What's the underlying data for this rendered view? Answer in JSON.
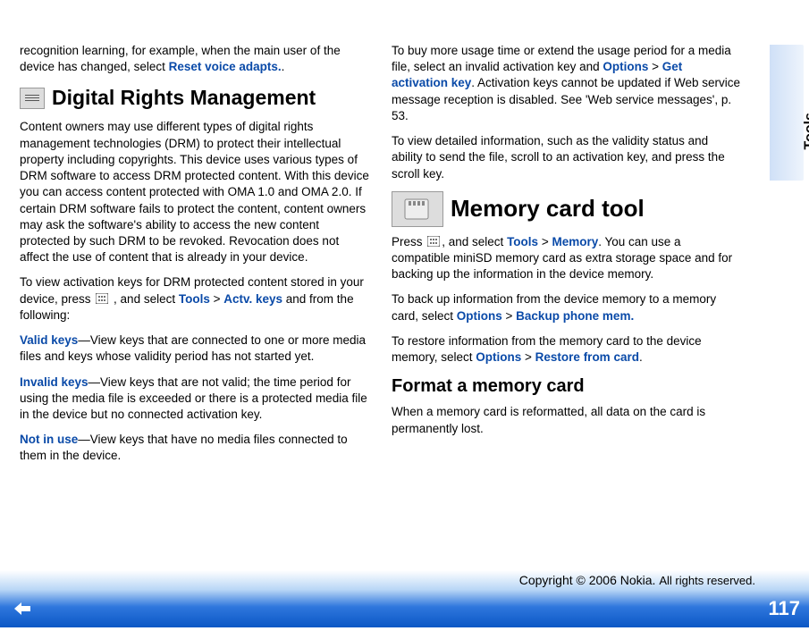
{
  "side_tab": "Tools",
  "left": {
    "intro_pre": "recognition learning, for example, when the main user of the device has changed, select ",
    "intro_link": "Reset voice adapts.",
    "intro_post": ".",
    "drm_heading": "Digital Rights Management",
    "drm_body": "Content owners may use different types of digital rights management technologies (DRM) to protect their intellectual property including copyrights. This device uses various types of DRM software to access DRM protected content. With this device you can access content protected with OMA 1.0 and OMA 2.0. If certain DRM software fails to protect the content, content owners may ask  the software's ability to access the new content protected by such DRM to be revoked. Revocation does not affect the use of content that is already in your device.",
    "view_pre": "To view activation keys for DRM protected content stored in your device, press ",
    "view_mid": " , and select ",
    "view_tools": "Tools",
    "view_gt": " > ",
    "view_actv": "Actv. keys",
    "view_post": " and from the following:",
    "valid_label": "Valid keys",
    "valid_body": "—View keys that are connected to one or more media files and keys whose validity period has not started yet.",
    "invalid_label": "Invalid keys",
    "invalid_body": "—View keys that are not valid; the time period for using the media file is exceeded or there is a protected media file in the device but no connected activation key.",
    "notinuse_label": "Not in use",
    "notinuse_body": "—View keys that have no media files connected to them in the device."
  },
  "right": {
    "buy_pre": "To buy more usage time or extend the usage period for a media file, select an invalid activation key and ",
    "buy_options": "Options",
    "buy_gt": " > ",
    "buy_getkey": "Get activation key",
    "buy_post": ". Activation keys cannot be updated if Web service message reception is disabled. See 'Web service messages', p. 53.",
    "detail_body": "To view detailed information, such as the validity status and ability to send the file, scroll to an activation key, and press the scroll key.",
    "mem_heading": "Memory card tool",
    "mem_press_pre": "Press ",
    "mem_press_mid": ", and select ",
    "mem_tools": "Tools",
    "mem_gt": " > ",
    "mem_memory": "Memory",
    "mem_press_post": ". You can use a compatible miniSD memory card as extra storage space and for backing up the information in the device memory.",
    "backup_pre": "To back up information from the device memory to a memory card, select ",
    "backup_options": "Options",
    "backup_gt": " > ",
    "backup_cmd": "Backup phone mem.",
    "restore_pre": "To restore information from the memory card to the device memory, select ",
    "restore_options": "Options",
    "restore_gt": " > ",
    "restore_cmd": "Restore from card",
    "restore_post": ".",
    "format_heading": "Format a memory card",
    "format_body": "When a memory card is reformatted, all data on the card is permanently lost."
  },
  "footer": {
    "copyright_brand": "Copyright © 2006 Nokia. ",
    "copyright_rest": "All rights reserved.",
    "page": "117"
  }
}
